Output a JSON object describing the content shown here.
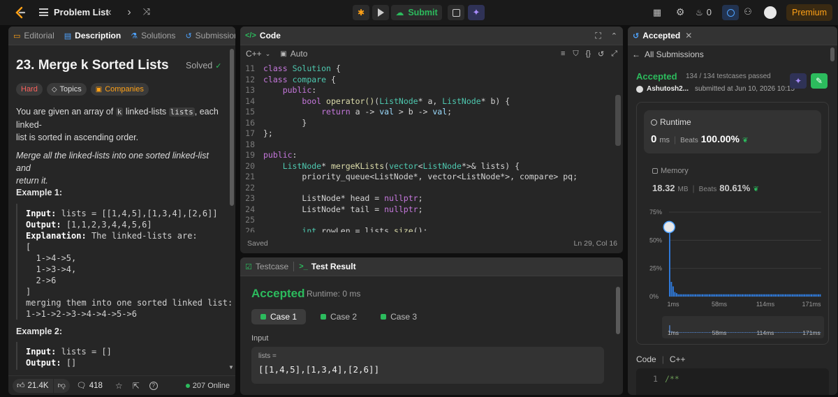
{
  "topbar": {
    "title": "Problem List",
    "submit_label": "Submit",
    "streak_count": "0",
    "premium_label": "Premium"
  },
  "left": {
    "tabs": {
      "editorial": "Editorial",
      "description": "Description",
      "solutions": "Solutions",
      "submissions": "Submissions"
    },
    "title": "23. Merge k Sorted Lists",
    "solved": "Solved",
    "tags": {
      "hard": "Hard",
      "topics": "Topics",
      "companies": "Companies"
    },
    "desc": {
      "p1a": "You are given an array of",
      "k": "k",
      "p1b": "linked-lists",
      "lists": "lists",
      "p1c": ", each linked-",
      "p1d": "list is sorted in ascending order.",
      "p2a": "Merge all the linked-lists into one sorted linked-list and",
      "p2b": "return it."
    },
    "example1": {
      "heading": "Example 1:",
      "input_label": "Input:",
      "input_value": "lists = [[1,4,5],[1,3,4],[2,6]]",
      "output_label": "Output:",
      "output_value": "[1,1,2,3,4,4,5,6]",
      "explanation_label": "Explanation:",
      "explanation_value": "The linked-lists are:",
      "lines": [
        "[",
        "  1->4->5,",
        "  1->3->4,",
        "  2->6",
        "]",
        "merging them into one sorted linked list:",
        "1->1->2->3->4->4->5->6"
      ]
    },
    "example2": {
      "heading": "Example 2:",
      "input_label": "Input:",
      "input_value": "lists = []",
      "output_label": "Output:",
      "output_value": "[]"
    },
    "footer": {
      "likes": "21.4K",
      "comments": "418",
      "online": "207 Online"
    }
  },
  "code": {
    "header": "Code",
    "language": "C++",
    "mode": "Auto",
    "status": "Saved",
    "cursor": "Ln 29, Col 16",
    "line_numbers": [
      "11",
      "12",
      "13",
      "14",
      "15",
      "16",
      "17",
      "18",
      "19",
      "20",
      "21",
      "22",
      "23",
      "24",
      "25",
      "26"
    ]
  },
  "testpanel": {
    "tab_testcase": "Testcase",
    "tab_result": "Test Result",
    "verdict": "Accepted",
    "runtime": "Runtime: 0 ms",
    "cases": [
      "Case 1",
      "Case 2",
      "Case 3"
    ],
    "input_label": "Input",
    "var_label": "lists =",
    "var_value": "[[1,4,5],[1,3,4],[2,6]]"
  },
  "right": {
    "tab": "Accepted",
    "back": "All Submissions",
    "verdict": "Accepted",
    "passed": "134 / 134 testcases passed",
    "user": "Ashutosh2...",
    "submitted": "submitted at Jun 10, 2026 10:15",
    "runtime_label": "Runtime",
    "runtime_value": "0",
    "runtime_unit": "ms",
    "beats_label": "Beats",
    "runtime_beats": "100.00%",
    "memory_label": "Memory",
    "memory_value": "18.32",
    "memory_unit": "MB",
    "memory_beats": "80.61%",
    "code_label": "Code",
    "code_lang": "C++",
    "code_line_no": "1",
    "code_line": "/**"
  },
  "chart_data": {
    "type": "bar",
    "y_ticks": [
      "75%",
      "50%",
      "25%",
      "0%"
    ],
    "ylim": [
      0,
      75
    ],
    "x_ticks": [
      "1ms",
      "58ms",
      "114ms",
      "171ms"
    ],
    "values": [
      58,
      13,
      9,
      4,
      3,
      2,
      2,
      2,
      2,
      2,
      2,
      2,
      2,
      2,
      2,
      2,
      2,
      2,
      2,
      2,
      2,
      2,
      2,
      2,
      2,
      2,
      2,
      2,
      2,
      2,
      2,
      2,
      2,
      2,
      2,
      2,
      2,
      2,
      2,
      2,
      2,
      2,
      2,
      2,
      2,
      2,
      2,
      2,
      2,
      2,
      2,
      2,
      2,
      2,
      2,
      2,
      2,
      2,
      2,
      2,
      2,
      2,
      2,
      2,
      2,
      2,
      2,
      2,
      2,
      2,
      2,
      2,
      2,
      2,
      2,
      2,
      2,
      2,
      2,
      2,
      2,
      2,
      2,
      2,
      2,
      2,
      2,
      2
    ],
    "highlight_index": 0,
    "colors": {
      "bar": "#2f7de1",
      "accent": "#2cbb5d"
    }
  }
}
